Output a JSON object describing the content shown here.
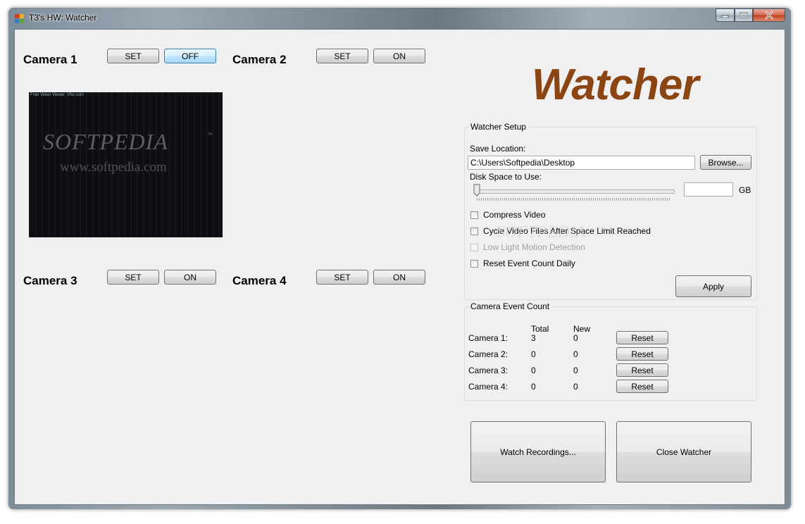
{
  "window": {
    "title": "T3's HW: Watcher",
    "controls": {
      "minimize": "minimize",
      "maximize": "maximize",
      "close": "close"
    }
  },
  "cameras": [
    {
      "label": "Camera 1",
      "set_label": "SET",
      "toggle_label": "OFF"
    },
    {
      "label": "Camera 2",
      "set_label": "SET",
      "toggle_label": "ON"
    },
    {
      "label": "Camera 3",
      "set_label": "SET",
      "toggle_label": "ON"
    },
    {
      "label": "Camera 4",
      "set_label": "SET",
      "toggle_label": "ON"
    }
  ],
  "preview": {
    "overlay": "Free Video Viewer, Vfor.com",
    "logo": "SOFTPEDIA",
    "tm": "™",
    "url": "www.softpedia.com"
  },
  "app_title": "Watcher",
  "setup": {
    "group_title": "Watcher Setup",
    "save_location_label": "Save Location:",
    "save_location_value": "C:\\Users\\Softpedia\\Desktop",
    "browse_label": "Browse...",
    "disk_space_label": "Disk Space to Use:",
    "disk_space_value": "",
    "disk_space_unit": "GB",
    "disk_space_fraction": 0.0,
    "options": [
      {
        "label": "Compress Video",
        "checked": false,
        "enabled": true
      },
      {
        "label": "Cycle Video Files After Space Limit Reached",
        "checked": false,
        "enabled": true
      },
      {
        "label": "Low Light Motion Detection",
        "checked": false,
        "enabled": false
      },
      {
        "label": "Reset Event Count Daily",
        "checked": false,
        "enabled": true
      }
    ],
    "apply_label": "Apply"
  },
  "events": {
    "group_title": "Camera Event Count",
    "total_header": "Total",
    "new_header": "New",
    "rows": [
      {
        "camera": "Camera 1:",
        "total": "3",
        "new": "0",
        "reset_label": "Reset"
      },
      {
        "camera": "Camera 2:",
        "total": "0",
        "new": "0",
        "reset_label": "Reset"
      },
      {
        "camera": "Camera 3:",
        "total": "0",
        "new": "0",
        "reset_label": "Reset"
      },
      {
        "camera": "Camera 4:",
        "total": "0",
        "new": "0",
        "reset_label": "Reset"
      }
    ]
  },
  "actions": {
    "watch_recordings_label": "Watch Recordings...",
    "close_watcher_label": "Close Watcher"
  },
  "colors": {
    "title_brown": "#8b4513",
    "client_bg": "#f0f0f0",
    "focus_blue": "#3c7fb1"
  },
  "watermark": "SOFTPEDIA"
}
